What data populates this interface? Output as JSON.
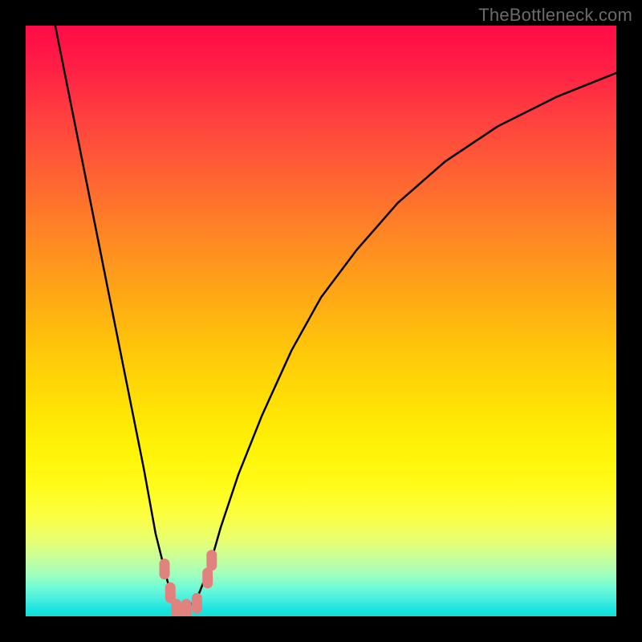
{
  "watermark": "TheBottleneck.com",
  "chart_data": {
    "type": "line",
    "title": "",
    "xlabel": "",
    "ylabel": "",
    "xlim": [
      0,
      100
    ],
    "ylim": [
      0,
      100
    ],
    "background_gradient": {
      "direction": "vertical",
      "stops": [
        {
          "pos": 0,
          "color": "#ff0b47"
        },
        {
          "pos": 0.25,
          "color": "#ff6134"
        },
        {
          "pos": 0.5,
          "color": "#ffbf0d"
        },
        {
          "pos": 0.75,
          "color": "#fbff2e"
        },
        {
          "pos": 1.0,
          "color": "#10e0d8"
        }
      ]
    },
    "series": [
      {
        "name": "bottleneck-curve",
        "color": "#000000",
        "x": [
          5,
          8,
          11,
          14,
          17,
          20,
          22,
          24,
          25.5,
          27,
          29,
          31,
          33,
          36,
          40,
          45,
          50,
          56,
          63,
          71,
          80,
          90,
          100
        ],
        "values": [
          100,
          85,
          70,
          55,
          40,
          25,
          14,
          6,
          1,
          1,
          3,
          8,
          15,
          24,
          34,
          45,
          54,
          62,
          70,
          77,
          83,
          88,
          92
        ]
      }
    ],
    "markers": {
      "name": "highlight-points",
      "color": "#e2827e",
      "points": [
        {
          "x": 23.5,
          "y": 8
        },
        {
          "x": 24.5,
          "y": 4
        },
        {
          "x": 25.5,
          "y": 1.2
        },
        {
          "x": 27.2,
          "y": 1.2
        },
        {
          "x": 29.0,
          "y": 2.2
        },
        {
          "x": 30.8,
          "y": 6.5
        },
        {
          "x": 31.5,
          "y": 9.5
        }
      ]
    }
  }
}
